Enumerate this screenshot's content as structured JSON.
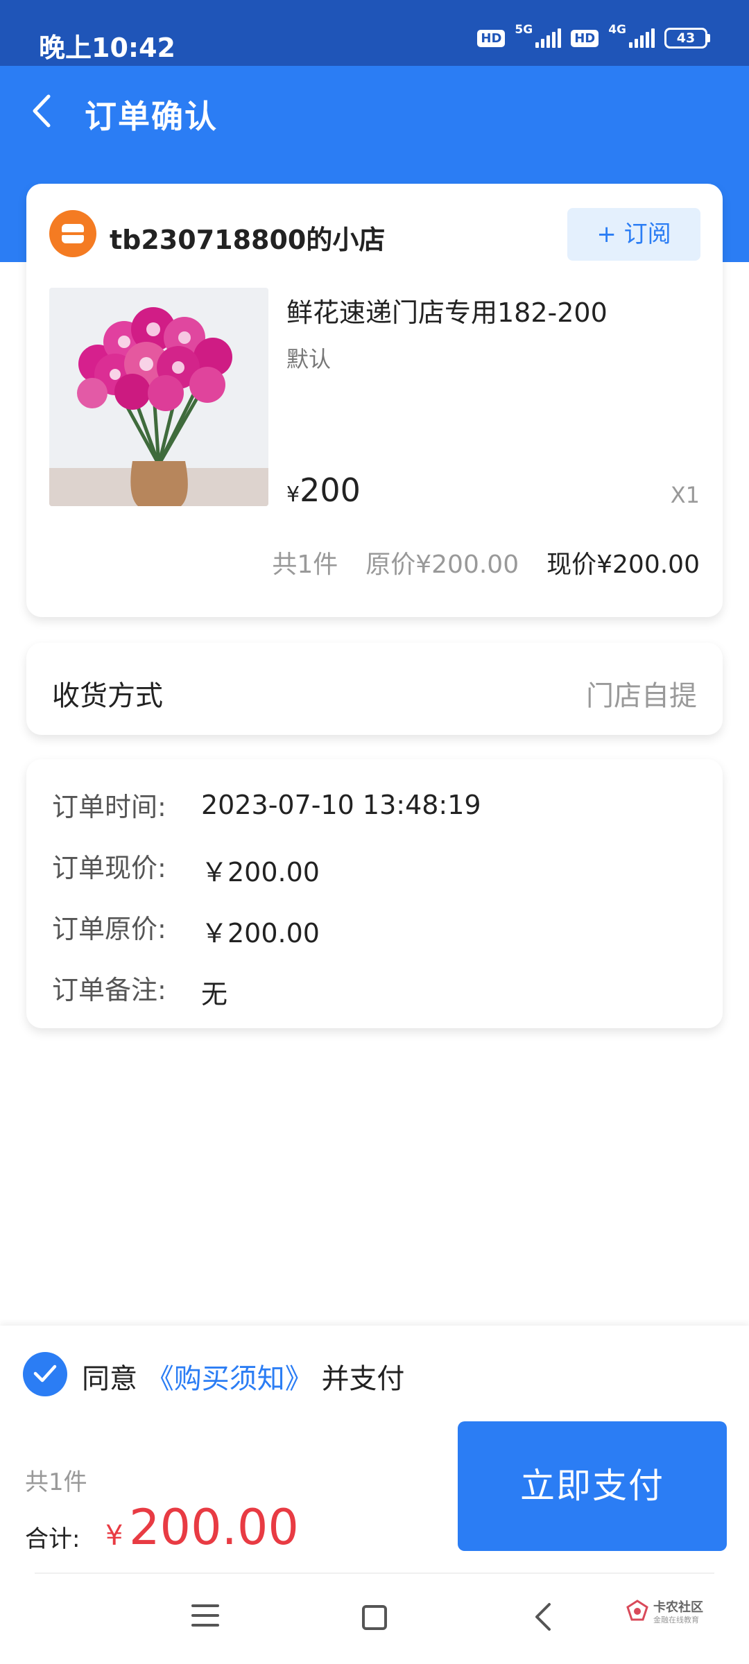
{
  "status_bar": {
    "time": "晚上10:42",
    "hd_badge": "HD",
    "network_1": "5G",
    "network_2": "4G",
    "battery": "43"
  },
  "header": {
    "title": "订单确认"
  },
  "shop": {
    "name": "tb230718800的小店",
    "subscribe_label": "+ 订阅"
  },
  "product": {
    "title": "鲜花速递门店专用182-200",
    "spec": "默认",
    "price_symbol": "¥",
    "price": "200",
    "quantity": "X1",
    "image_icon": "pink-carnation-bouquet-photo"
  },
  "order_summary": {
    "count": "共1件",
    "original": "原价¥200.00",
    "current": "现价¥200.00"
  },
  "delivery": {
    "label": "收货方式",
    "value": "门店自提"
  },
  "order_info": [
    {
      "key": "订单时间:",
      "value": "2023-07-10 13:48:19"
    },
    {
      "key": "订单现价:",
      "value": "￥200.00"
    },
    {
      "key": "订单原价:",
      "value": "￥200.00"
    },
    {
      "key": "订单备注:",
      "value": "无"
    }
  ],
  "footer": {
    "agree_prefix": "同意",
    "agree_link": "《购买须知》",
    "agree_suffix": "并支付",
    "count": "共1件",
    "total_label": "合计:",
    "total_symbol": "¥",
    "total_amount": "200.00",
    "pay_label": "立即支付"
  },
  "watermark": {
    "text": "卡农社区",
    "sub": "金融在线教育"
  },
  "colors": {
    "status_bar": "#1f55b8",
    "header": "#2b7df4",
    "accent": "#2b7df4",
    "price_red": "#e83b43",
    "shop_logo": "#f47b22"
  }
}
